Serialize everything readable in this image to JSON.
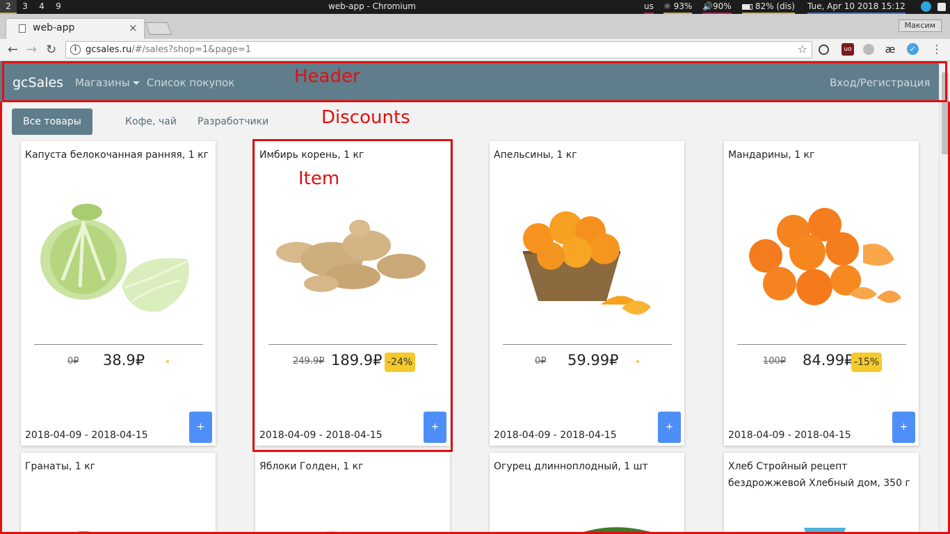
{
  "wm": {
    "workspaces": [
      "2",
      "3",
      "4",
      "9"
    ],
    "window_title": "web-app - Chromium",
    "layout": "us",
    "brightness": "93%",
    "volume": "90%",
    "battery": "82% (dis)",
    "clock": "Tue, Apr 10 2018 15:12"
  },
  "browser": {
    "tab_title": "web-app",
    "tab_close": "×",
    "profile": "Максим",
    "url_host": "gcsales.ru",
    "url_path": "/#/sales?shop=1&page=1",
    "back": "←",
    "forward": "→",
    "reload": "↻",
    "star": "☆",
    "menu": "⋮",
    "info": "i",
    "ext_ae": "æ"
  },
  "header": {
    "brand": "gcSales",
    "nav_shops": "Магазины",
    "nav_list": "Список покупок",
    "login": "Вход/Регистрация"
  },
  "filters": {
    "all": "Все товары",
    "coffee": "Кофе, чай",
    "devs": "Разработчики"
  },
  "annotations": {
    "header": "Header",
    "discounts": "Discounts",
    "item": "Item"
  },
  "products": [
    {
      "title": "Капуста белокочанная ранняя, 1 кг",
      "old_price": "0₽",
      "price": "38.9₽",
      "discount": "",
      "dates": "2018-04-09 - 2018-04-15",
      "add": "+"
    },
    {
      "title": "Имбирь корень, 1 кг",
      "old_price": "249.9₽",
      "price": "189.9₽",
      "discount": "-24%",
      "dates": "2018-04-09 - 2018-04-15",
      "add": "+"
    },
    {
      "title": "Апельсины, 1 кг",
      "old_price": "0₽",
      "price": "59.99₽",
      "discount": "",
      "dates": "2018-04-09 - 2018-04-15",
      "add": "+"
    },
    {
      "title": "Мандарины, 1 кг",
      "old_price": "100₽",
      "price": "84.99₽",
      "discount": "-15%",
      "dates": "2018-04-09 - 2018-04-15",
      "add": "+"
    },
    {
      "title": "Гранаты, 1 кг"
    },
    {
      "title": "Яблоки Голден, 1 кг"
    },
    {
      "title": "Огурец длинноплодный, 1 шт"
    },
    {
      "title": "Хлеб Стройный рецепт бездрожжевой Хлебный дом, 350 г"
    }
  ]
}
